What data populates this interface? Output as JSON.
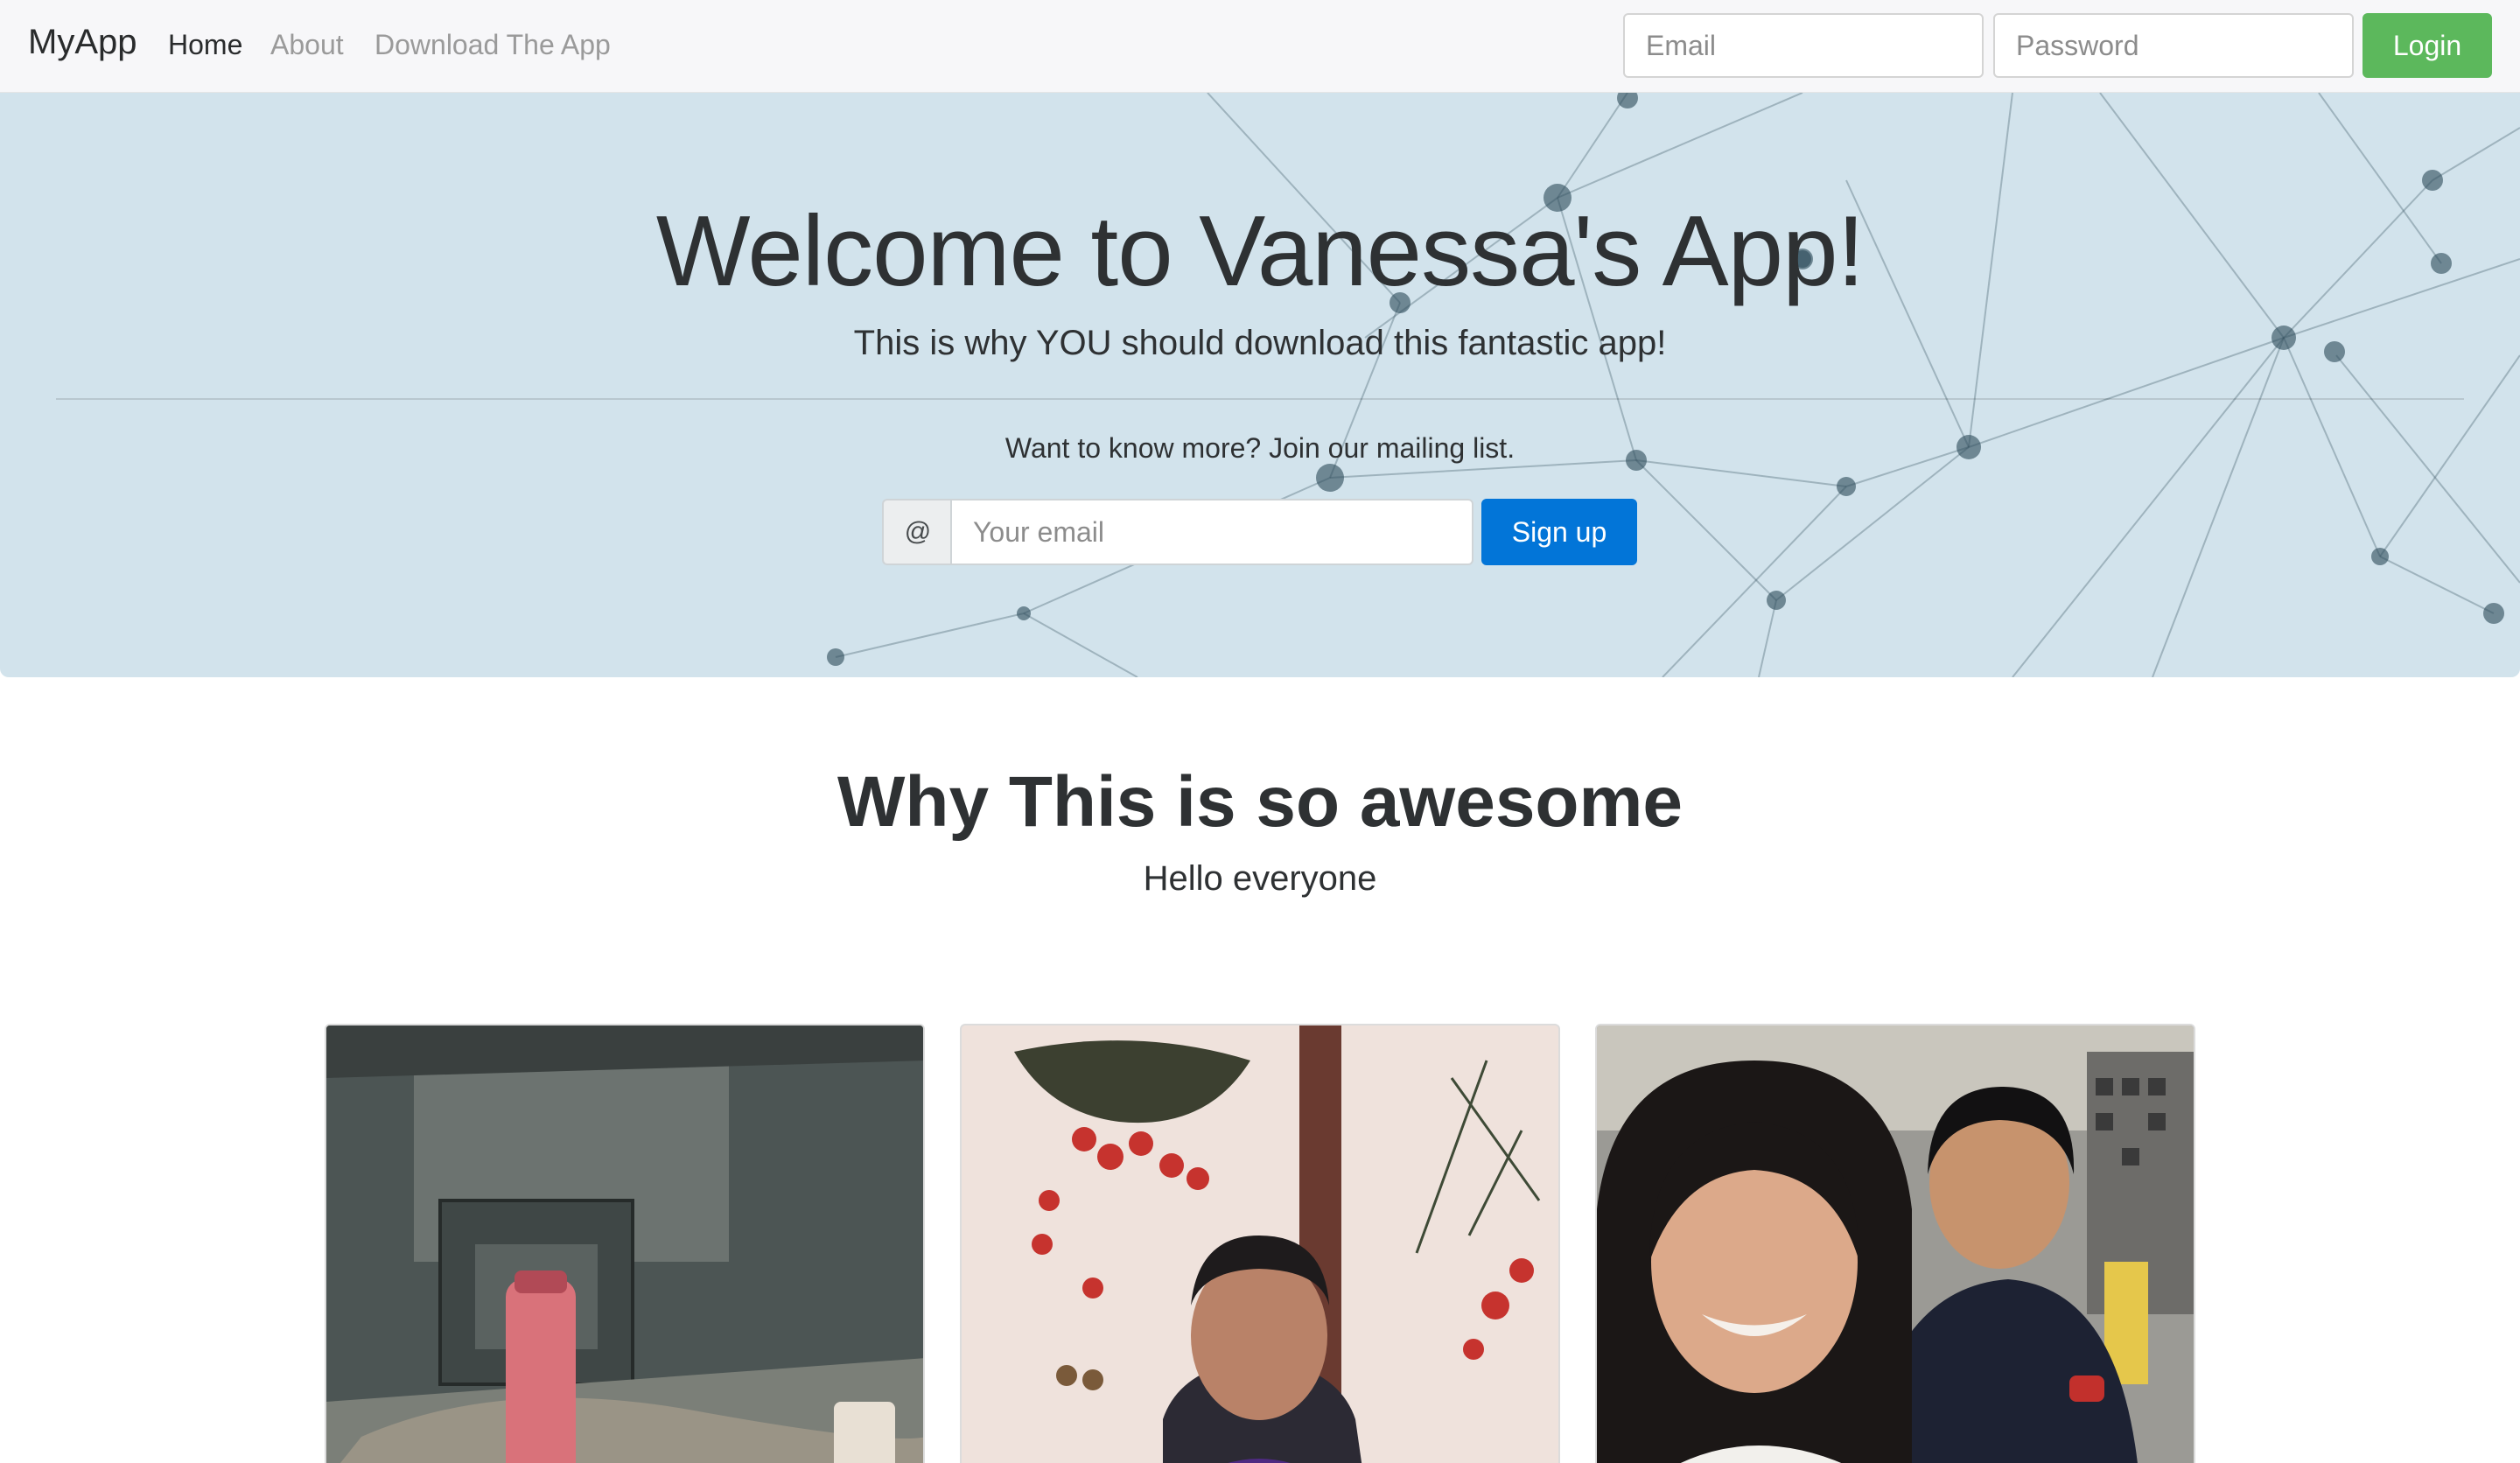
{
  "navbar": {
    "brand": "MyApp",
    "links": [
      "Home",
      "About",
      "Download The App"
    ],
    "email_placeholder": "Email",
    "password_placeholder": "Password",
    "login_label": "Login"
  },
  "hero": {
    "title": "Welcome to Vanessa's App!",
    "lead": "This is why YOU should download this fantastic app!",
    "mailing_text": "Want to know more? Join our mailing list.",
    "addon": "@",
    "email_placeholder": "Your email",
    "signup_label": "Sign up"
  },
  "section": {
    "title": "Why This is so awesome",
    "subtitle": "Hello everyone"
  },
  "cards": [
    {
      "image": "photo-bottle-on-table"
    },
    {
      "image": "photo-man-with-painting"
    },
    {
      "image": "photo-two-people-selfie"
    }
  ],
  "colors": {
    "navbar_bg": "#f7f7f9",
    "hero_bg": "#d2e3ec",
    "login_green": "#5cb85c",
    "signup_blue": "#0275d8",
    "text_dark": "#2e3133",
    "nav_muted": "#9a9a9a"
  }
}
